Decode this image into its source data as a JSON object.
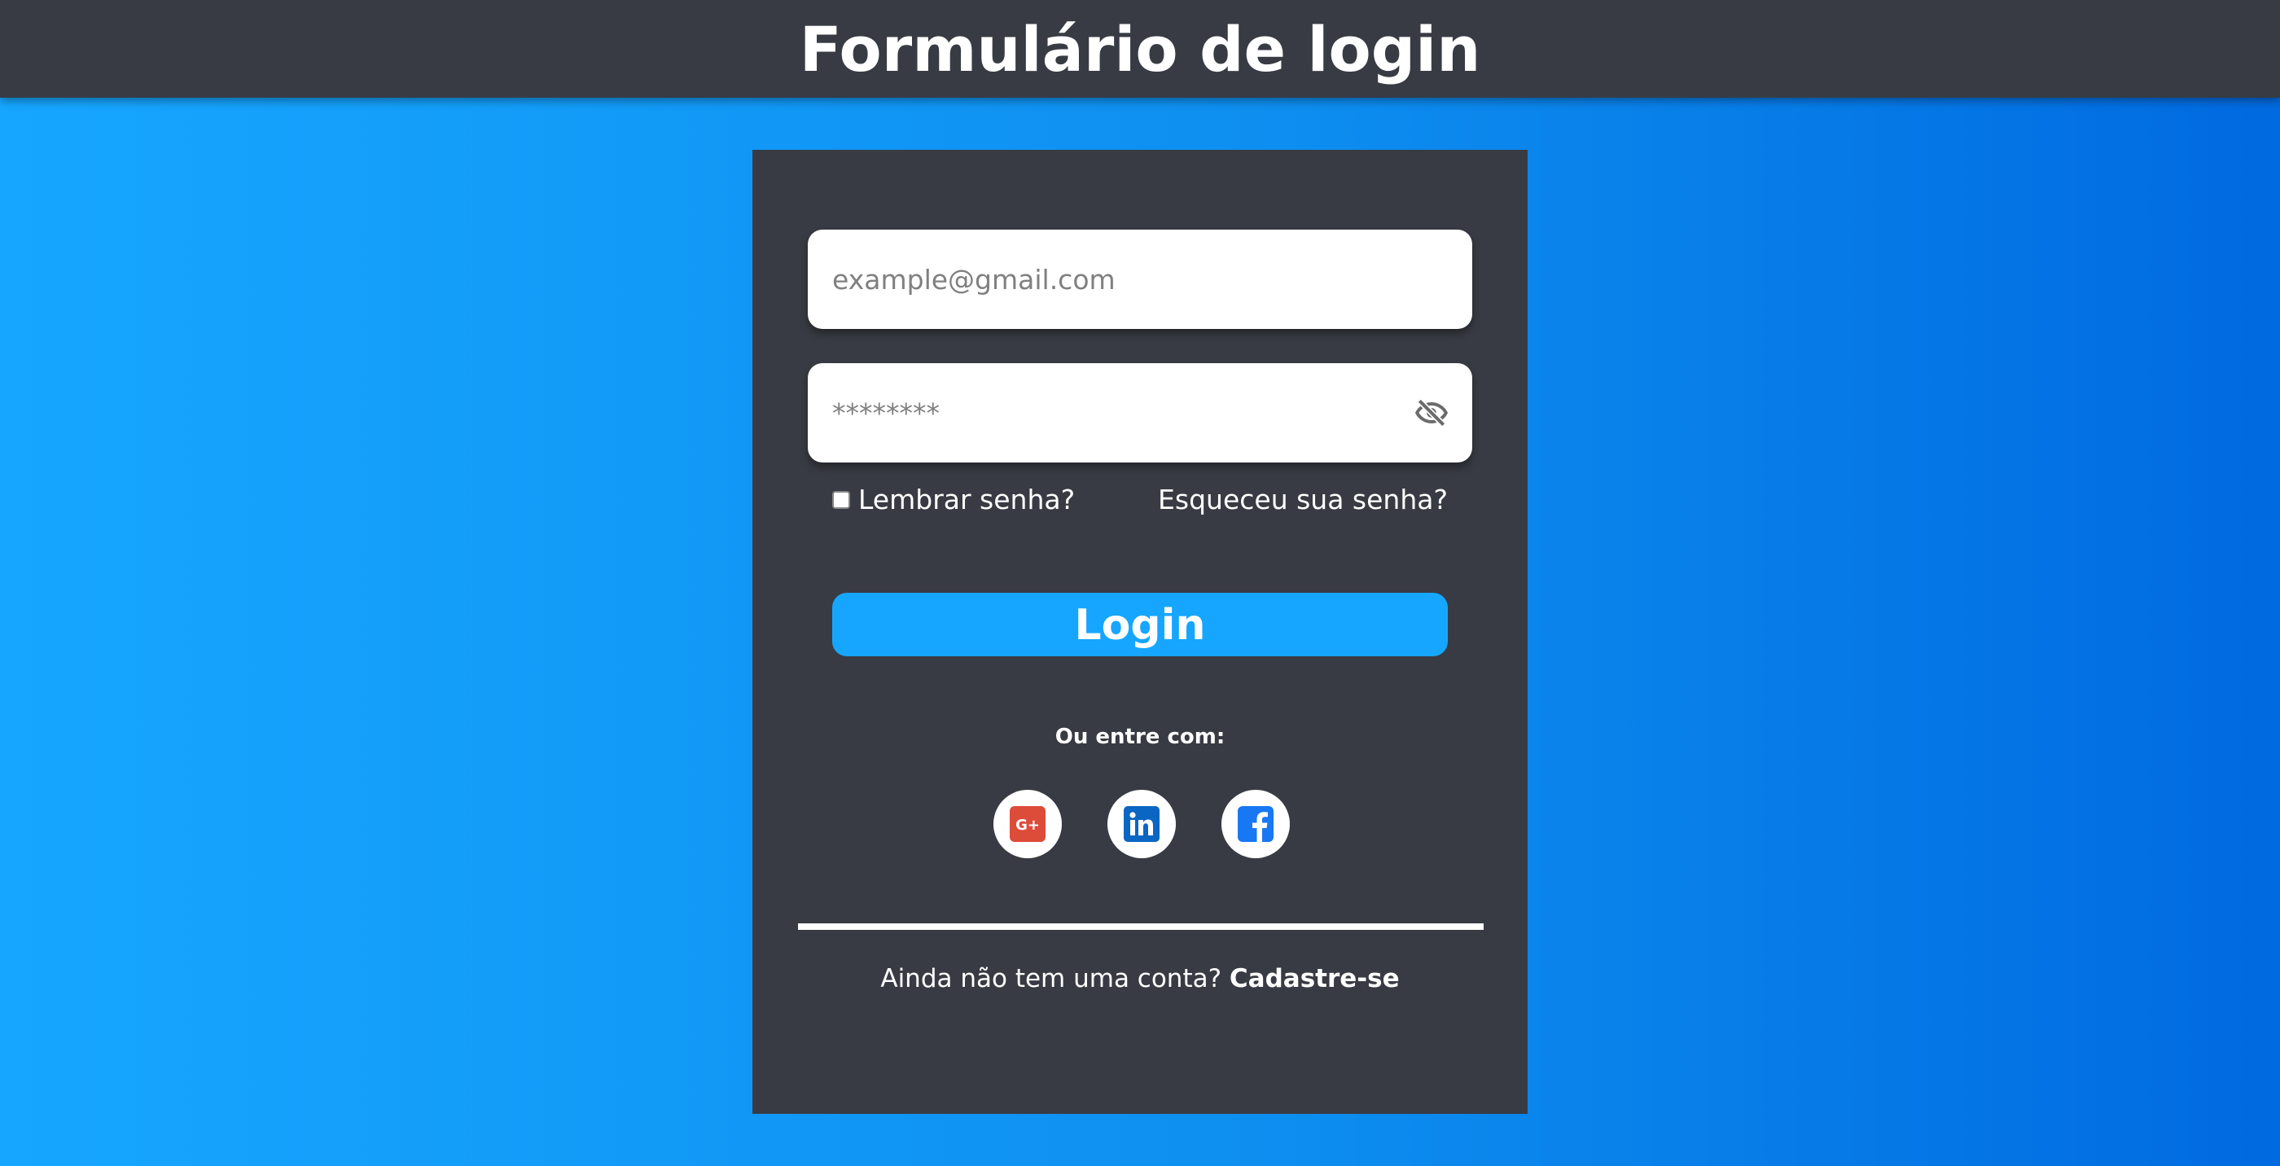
{
  "header": {
    "title": "Formulário de login"
  },
  "form": {
    "email_placeholder": "example@gmail.com",
    "password_placeholder": "********",
    "password_toggle_icon": "eye-slash-icon",
    "remember_label": "Lembrar senha?",
    "remember_checked": false,
    "forgot_label": "Esqueceu sua senha?",
    "login_label": "Login",
    "or_label": "Ou entre com:",
    "socials": [
      {
        "name": "google-plus",
        "icon": "google-plus-icon",
        "color": "#dd4b39"
      },
      {
        "name": "linkedin",
        "icon": "linkedin-icon",
        "color": "#0a66c2"
      },
      {
        "name": "facebook",
        "icon": "facebook-icon",
        "color": "#1877f2"
      }
    ],
    "signup_prompt": "Ainda não tem uma conta?",
    "signup_link": "Cadastre-se"
  },
  "colors": {
    "header_bg": "#383b43",
    "card_bg": "#383b43",
    "accent": "#16a6ff",
    "background_start": "#16a6ff",
    "background_end": "#006ae0"
  }
}
